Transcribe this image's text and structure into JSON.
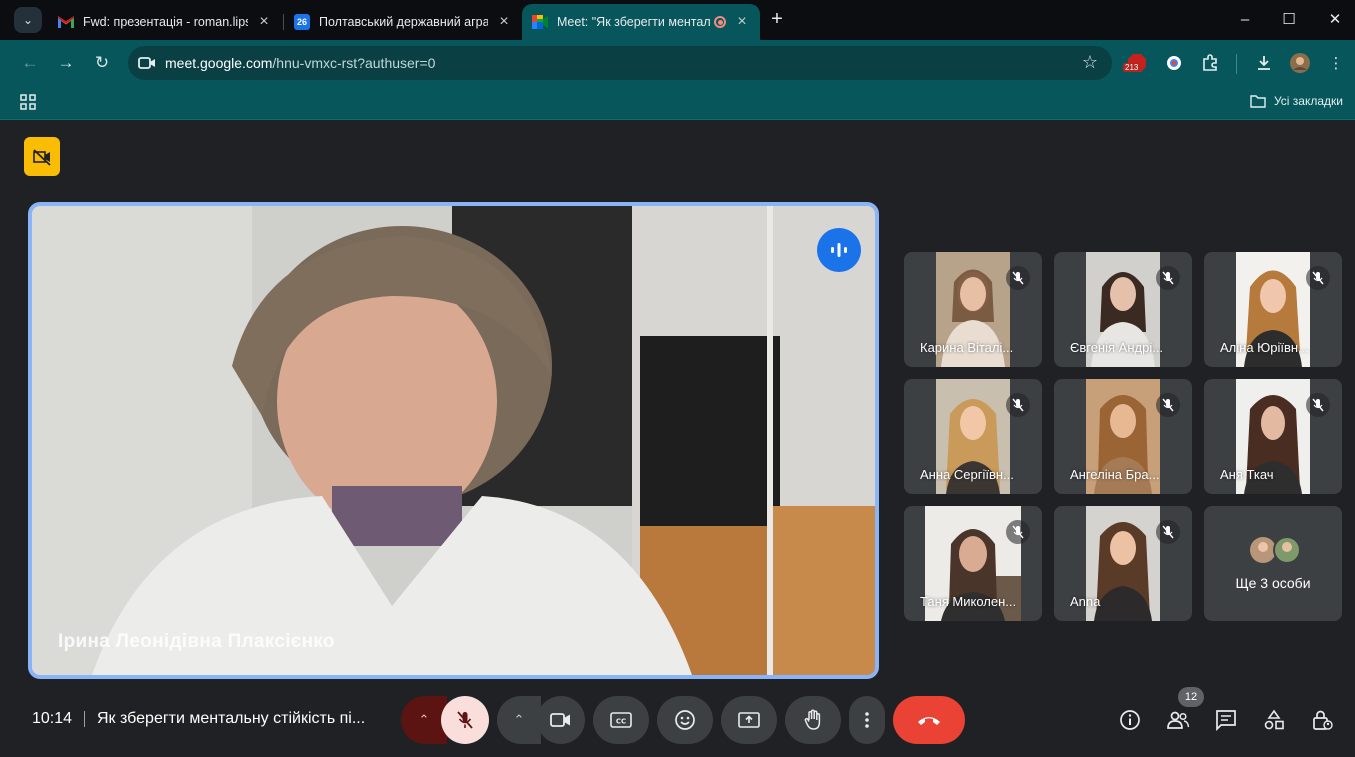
{
  "browser": {
    "tabs": [
      {
        "title": "Fwd: презентація - roman.lipsk",
        "favicon": "gmail-icon"
      },
      {
        "title": "Полтавський державний аграр",
        "favicon": "calendar-icon",
        "favicon_text": "26"
      },
      {
        "title": "Meet: \"Як зберегти ментал",
        "favicon": "meet-icon",
        "active": true
      }
    ],
    "url_host": "meet.google.com",
    "url_path": "/hnu-vmxc-rst?authuser=0",
    "extension_badge": "213",
    "bookmarks_folder": "Усі закладки"
  },
  "meet": {
    "speaker": {
      "name": "Ірина Леонідівна Плаксієнко"
    },
    "participants": [
      {
        "name": "Карина Віталі..."
      },
      {
        "name": "Євгенія Андрі..."
      },
      {
        "name": "Аліна Юріївн..."
      },
      {
        "name": "Анна Сергіївн..."
      },
      {
        "name": "Ангеліна Бра..."
      },
      {
        "name": "Аня Ткач"
      },
      {
        "name": "Таня Миколен..."
      },
      {
        "name": "Anna"
      }
    ],
    "more_label": "Ще 3 особи",
    "time": "10:14",
    "meeting_title": "Як зберегти ментальну стійкість пі...",
    "people_count": "12"
  },
  "colors": {
    "chrome_bg": "#06565b",
    "tabstrip_bg": "#0b0d10",
    "meet_bg": "#202124",
    "speaking_border": "#8ab4f8",
    "hangup": "#ea4335",
    "warning": "#fbbc04"
  }
}
